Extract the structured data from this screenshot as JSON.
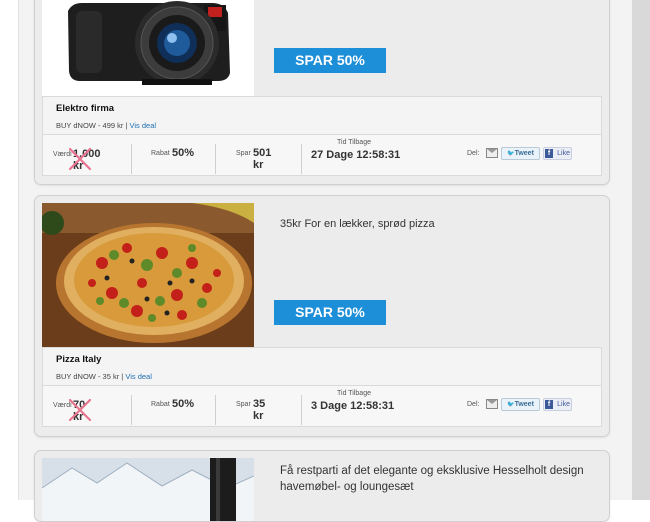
{
  "cards": [
    {
      "name": "Elektro firma",
      "buy_prefix": "BUY dNOW - 499 kr | ",
      "deal_link": "Vis deal",
      "spar_banner": "SPAR 50%",
      "stats": {
        "verdi_label": "Værdi",
        "verdi_value": "1.000 kr",
        "rabat_label": "Rabat",
        "rabat_value": "50%",
        "spar_label": "Spar",
        "spar_value": "501 kr",
        "tid_label": "Tid Tilbage",
        "tid_value": "27 Dage 12:58:31",
        "del_label": "Del:",
        "tweet_label": "Tweet",
        "like_label": "Like"
      }
    },
    {
      "name": "Pizza Italy",
      "description": "35kr For en lækker, sprød pizza",
      "buy_prefix": "BUY dNOW - 35 kr | ",
      "deal_link": "Vis deal",
      "spar_banner": "SPAR 50%",
      "stats": {
        "verdi_label": "Værdi",
        "verdi_value": "70 kr",
        "rabat_label": "Rabat",
        "rabat_value": "50%",
        "spar_label": "Spar",
        "spar_value": "35 kr",
        "tid_label": "Tid Tilbage",
        "tid_value": "3 Dage 12:58:31",
        "del_label": "Del:",
        "tweet_label": "Tweet",
        "like_label": "Like"
      }
    },
    {
      "description": "Få restparti af det elegante og eksklusive Hesselholt design havemøbel- og loungesæt"
    }
  ],
  "icons": {
    "camera": "camera-photo",
    "pizza": "pizza-photo",
    "furniture": "snowy-mountain-photo",
    "mail": "mail-icon",
    "twitter": "twitter-icon",
    "facebook": "facebook-icon",
    "strike": "cross-out-icon"
  },
  "colors": {
    "accent": "#1d8ed8",
    "link": "#1f6fb2",
    "cross": "#e8748f"
  }
}
